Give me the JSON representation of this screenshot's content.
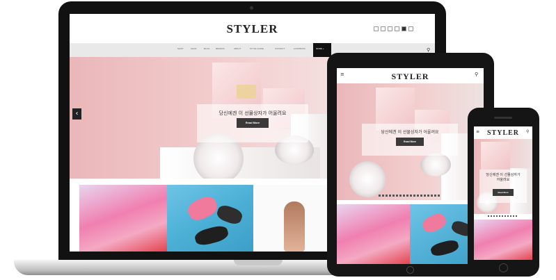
{
  "brand": "STYLER",
  "nav": {
    "items": [
      "SHOP",
      "SHOP",
      "BLOG",
      "BRANDS",
      "ABOUT",
      "STYLE GUIDE",
      "CONTACT",
      "LOOKBOOK",
      "MORE +"
    ],
    "search_icon": "search-icon"
  },
  "social_icons": [
    "rss-icon",
    "twitter-icon",
    "facebook-icon",
    "instagram-icon",
    "youtube-icon",
    "google-plus-icon"
  ],
  "hero": {
    "caption": "당신에겐 이 선물상자가 어울려요",
    "caption_phone_line1": "당신에겐 이 선물상자가",
    "caption_phone_line2": "어울려요",
    "button": "Read More"
  },
  "icons": {
    "prev": "chevron-left-icon",
    "menu": "hamburger-menu-icon"
  },
  "colors": {
    "hero_pink": "#f1c6c8",
    "button_dark": "#3a3a3a",
    "nav_gray": "#e9e9e9",
    "device_black": "#151515"
  }
}
